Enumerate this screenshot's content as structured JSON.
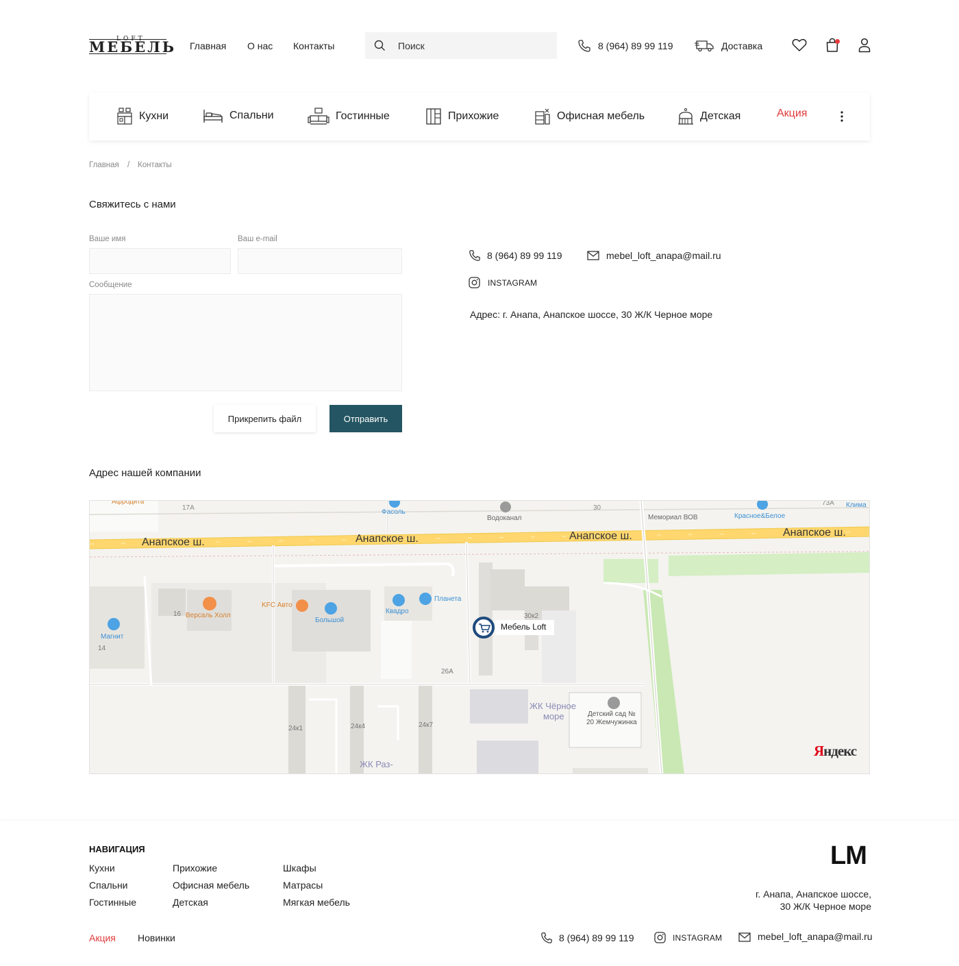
{
  "header": {
    "logo_top": "LOFT",
    "logo_main": "МЕБЕЛЬ",
    "nav": [
      "Главная",
      "О нас",
      "Контакты"
    ],
    "search_placeholder": "Поиск",
    "phone": "8 (964) 89 99 119",
    "delivery": "Доставка"
  },
  "categories": [
    "Кухни",
    "Спальни",
    "Гостинные",
    "Прихожие",
    "Офисная мебель",
    "Детская",
    "Акция"
  ],
  "breadcrumb": [
    "Главная",
    "/",
    "Контакты"
  ],
  "contact_form": {
    "title": "Свяжитесь с нами",
    "name_label": "Ваше имя",
    "email_label": "Ваш e-mail",
    "message_label": "Сообщение",
    "attach_label": "Прикрепить файл",
    "send_label": "Отправить"
  },
  "contact_info": {
    "phone": "8 (964) 89 99 119",
    "email": "mebel_loft_anapa@mail.ru",
    "instagram": "INSTAGRAM",
    "address": "Адрес: г. Анапа, Анапское шоссе, 30 Ж/К Черное море"
  },
  "map_section": {
    "title": "Адрес нашей компании",
    "road_labels": [
      "Анапское ш.",
      "Анапское ш.",
      "Анапское ш.",
      "Анапское ш."
    ],
    "places": [
      "Афродита",
      "17А",
      "Фасоль",
      "Водоканал",
      "30",
      "Мемориал ВОВ",
      "Красное&Белое",
      "73А",
      "Клима",
      "16",
      "Версаль Холл",
      "KFC Авто",
      "Большой",
      "Квадро",
      "Планета",
      "30к2",
      "Магнит",
      "14",
      "26А",
      "ЖК Чёрное",
      "море",
      "Детский сад №",
      "20 Жемчужинка",
      "24к1",
      "24к4",
      "24к7",
      "ЖК Раз-"
    ],
    "marker": "Мебель Loft",
    "provider": "Яндекс"
  },
  "footer": {
    "nav_title": "НАВИГАЦИЯ",
    "col1": [
      "Кухни",
      "Спальни",
      "Гостинные"
    ],
    "col2": [
      "Прихожие",
      "Офисная мебель",
      "Детская"
    ],
    "col3": [
      "Шкафы",
      "Матрасы",
      "Мягкая мебель"
    ],
    "sale": "Акция",
    "new": "Новинки",
    "logo": "LM",
    "address_line1": "г. Анапа, Анапское шоссе,",
    "address_line2": "30 Ж/К Черное море",
    "phone": "8 (964) 89 99 119",
    "instagram": "INSTAGRAM",
    "email": "mebel_loft_anapa@mail.ru"
  },
  "colors": {
    "accent": "#245562",
    "sale": "#e03a3a",
    "badge": "#e63b3b"
  }
}
